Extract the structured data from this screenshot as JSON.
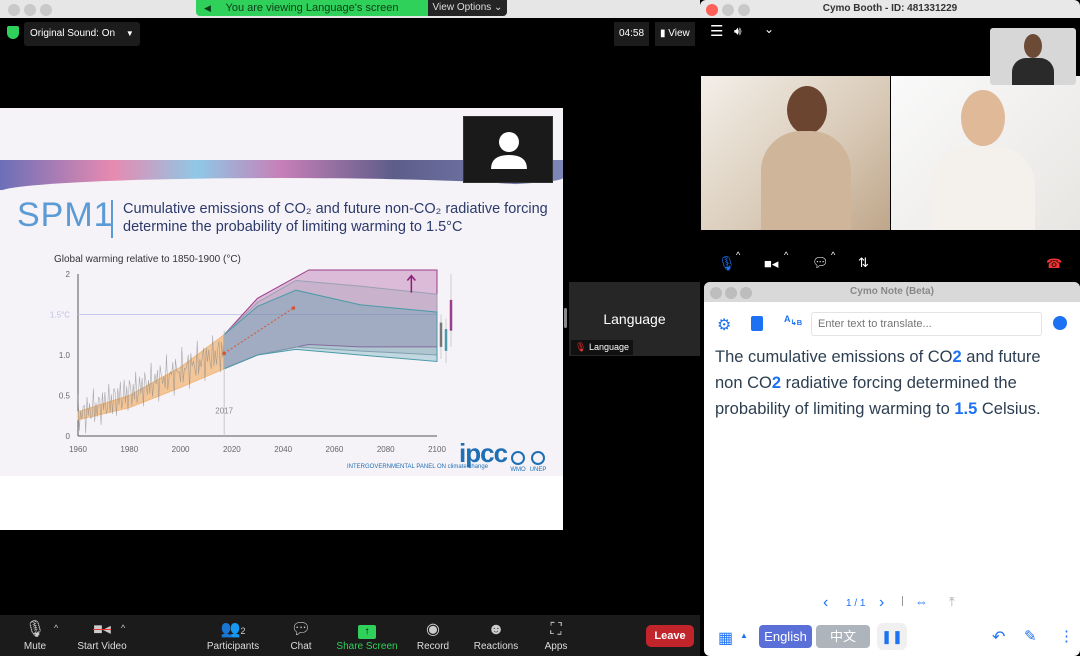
{
  "zoom": {
    "banner_text": "You are viewing Language's screen",
    "view_options": "View Options ⌄",
    "original_sound": "Original Sound: On",
    "timer": "04:58",
    "view_label": "View",
    "language_tile": {
      "name": "Language",
      "label": "Language"
    },
    "toolbar": {
      "mute": "Mute",
      "start_video": "Start Video",
      "participants": "Participants",
      "participants_count": "2",
      "chat": "Chat",
      "share_screen": "Share Screen",
      "record": "Record",
      "reactions": "Reactions",
      "apps": "Apps",
      "leave": "Leave"
    },
    "colors": {
      "share_green": "#2fd15a",
      "leave_red": "#c2242b"
    }
  },
  "slide": {
    "code": "SPM1",
    "title_line1": "Cumulative emissions of CO₂ and future non-CO₂ radiative forcing",
    "title_line2": "determine the probability of limiting warming to 1.5°C",
    "logo": "ipcc",
    "logo_sub": "INTERGOVERNMENTAL PANEL ON climate change",
    "partner_logos": [
      "WMO",
      "UNEP"
    ]
  },
  "chart_data": {
    "type": "area",
    "ylabel": "Global warming relative to 1850-1900 (°C)",
    "x_ticks": [
      "1960",
      "1980",
      "2000",
      "2020",
      "2040",
      "2060",
      "2080",
      "2100"
    ],
    "y_ticks": [
      "0",
      "0.5",
      "1.0",
      "1.5",
      "2"
    ],
    "xlim": [
      1960,
      2100
    ],
    "ylim": [
      0,
      2
    ],
    "reference_line": {
      "value": 1.5,
      "label": "1.5°C"
    },
    "annotation": "2017",
    "series": [
      {
        "x": [
          1960,
          1980,
          2000,
          2017
        ],
        "lower": [
          0.2,
          0.35,
          0.6,
          0.83
        ],
        "upper": [
          0.3,
          0.5,
          0.85,
          1.25
        ],
        "color": "#f2b77a"
      },
      {
        "x": [
          2017,
          2030,
          2045,
          2070,
          2100
        ],
        "lower": [
          0.83,
          1.0,
          1.1,
          1.05,
          1.0
        ],
        "upper": [
          1.25,
          1.65,
          1.92,
          1.85,
          1.75
        ],
        "color": "#9aa0b3"
      },
      {
        "x": [
          2017,
          2030,
          2045,
          2070,
          2100
        ],
        "lower": [
          0.83,
          1.0,
          1.07,
          1.0,
          0.92
        ],
        "upper": [
          1.25,
          1.6,
          1.8,
          1.62,
          1.53
        ],
        "color": "#4a9aa8"
      },
      {
        "x": [
          2017,
          2030,
          2050,
          2070,
          2100
        ],
        "lower": [
          0.83,
          1.0,
          1.13,
          1.1,
          1.1
        ],
        "upper": [
          1.25,
          1.7,
          2.05,
          2.05,
          2.05
        ],
        "color": "#9b3c8c"
      }
    ]
  },
  "booth": {
    "title": "Cymo Booth - ID: 481331229"
  },
  "note": {
    "title": "Cymo Note (Beta)",
    "input_placeholder": "Enter text to translate...",
    "translation": [
      {
        "t": "The cumulative emissions of CO"
      },
      {
        "b": "2"
      },
      {
        "t": " and future non CO"
      },
      {
        "b": "2"
      },
      {
        "t": " radiative forcing determined the probability of limiting warming to "
      },
      {
        "b": "1.5"
      },
      {
        "t": " Celsius."
      }
    ],
    "page": "1 / 1",
    "lang_english": "English",
    "lang_chinese": "中文",
    "colors": {
      "accent": "#1d72f3",
      "english_btn": "#5b6fd9",
      "chinese_btn": "#aeb4bb"
    }
  }
}
